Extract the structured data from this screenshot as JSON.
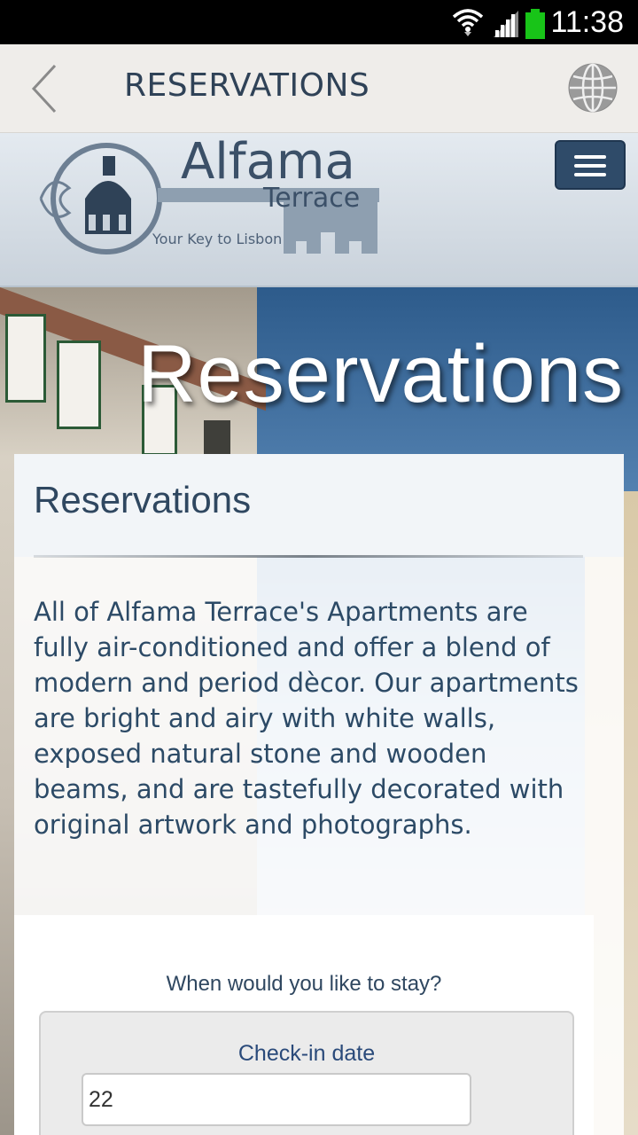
{
  "status_bar": {
    "time": "11:38",
    "icons": [
      "wifi-icon",
      "signal-icon",
      "battery-icon"
    ],
    "battery_color": "#18c418"
  },
  "header": {
    "title": "RESERVATIONS",
    "back_icon": "chevron-left-icon",
    "globe_icon": "globe-icon"
  },
  "logo": {
    "name": "Alfama",
    "sub": "Terrace",
    "tagline": "Your Key to Lisbon"
  },
  "menu": {
    "icon": "hamburger-menu-icon"
  },
  "hero": {
    "title": "Reservations"
  },
  "card": {
    "title": "Reservations",
    "body": "All of Alfama Terrace's Apartments are fully air-conditioned and offer a blend of modern and period dècor. Our apartments are bright and airy with white walls, exposed natural stone and wooden beams, and are tastefully decorated with original artwork and photographs."
  },
  "form": {
    "question": "When would you like to stay?",
    "checkin_label": "Check-in date",
    "checkin_value": "22"
  },
  "colors": {
    "header_bg": "#efedea",
    "title_text": "#2f4257",
    "menu_button": "#2f4b69",
    "body_text": "#2c4a66"
  }
}
